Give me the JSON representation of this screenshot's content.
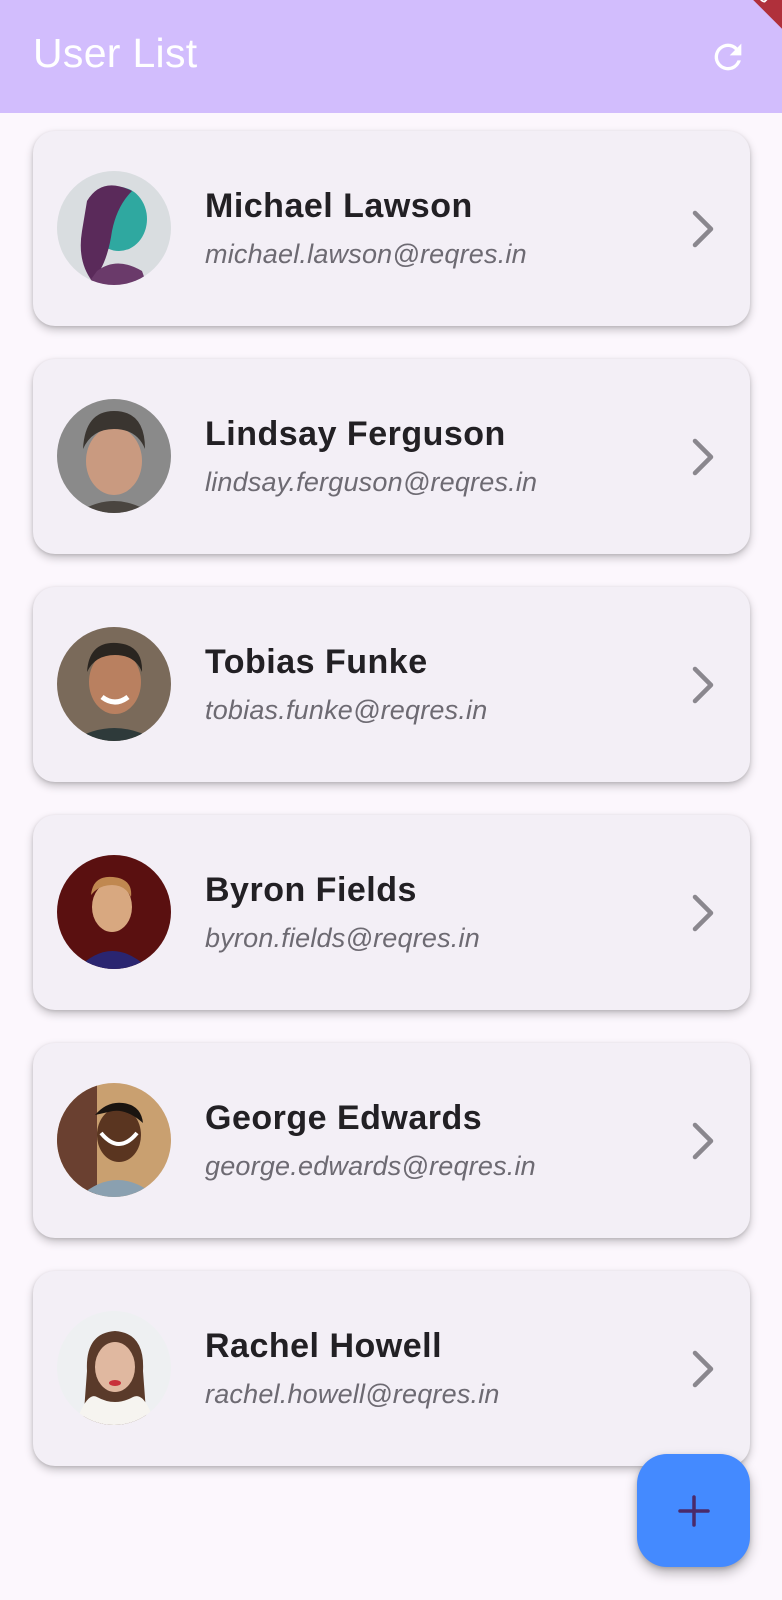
{
  "app_bar": {
    "title": "User List",
    "refresh_icon": "refresh-icon",
    "background": "#d2bdfd",
    "debug_banner": "DEBUG"
  },
  "users": [
    {
      "name": "Michael Lawson",
      "email": "michael.lawson@reqres.in",
      "avatar_colors": [
        "#5a2a5a",
        "#2fa8a0",
        "#d9dde0"
      ]
    },
    {
      "name": "Lindsay Ferguson",
      "email": "lindsay.ferguson@reqres.in",
      "avatar_colors": [
        "#3a3530",
        "#c99a80",
        "#8a8a8a"
      ]
    },
    {
      "name": "Tobias Funke",
      "email": "tobias.funke@reqres.in",
      "avatar_colors": [
        "#2a2520",
        "#b98060",
        "#7a6a5a"
      ]
    },
    {
      "name": "Byron Fields",
      "email": "byron.fields@reqres.in",
      "avatar_colors": [
        "#5a1010",
        "#d8a880",
        "#2a2570"
      ]
    },
    {
      "name": "George Edwards",
      "email": "george.edwards@reqres.in",
      "avatar_colors": [
        "#6a4030",
        "#5a3520",
        "#c9a070"
      ]
    },
    {
      "name": "Rachel Howell",
      "email": "rachel.howell@reqres.in",
      "avatar_colors": [
        "#eef0f2",
        "#e0b8a0",
        "#5a3a2a"
      ]
    }
  ],
  "fab": {
    "icon": "plus-icon",
    "color": "#448aff",
    "icon_color": "#4a2a6a"
  }
}
